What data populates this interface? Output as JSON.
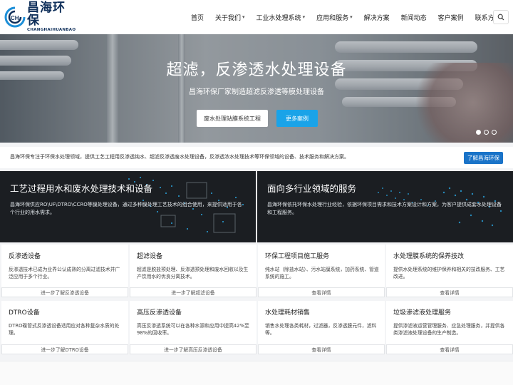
{
  "brand": {
    "name_cn": "昌海环保",
    "name_en": "CHANGHAIHUANBAO",
    "logo_mark": "CH"
  },
  "nav": {
    "items": [
      {
        "label": "首页",
        "dropdown": false
      },
      {
        "label": "关于我们",
        "dropdown": true
      },
      {
        "label": "工业水处理系统",
        "dropdown": true
      },
      {
        "label": "应用和服务",
        "dropdown": true
      },
      {
        "label": "解决方案",
        "dropdown": false
      },
      {
        "label": "新闻动态",
        "dropdown": false
      },
      {
        "label": "客户案例",
        "dropdown": false
      },
      {
        "label": "联系方式",
        "dropdown": false
      }
    ],
    "caret": "▾",
    "search_icon": "search-icon"
  },
  "hero": {
    "title": "超滤，反渗透水处理设备",
    "subtitle": "昌海环保厂家制造超滤反渗透等膜处理设备",
    "primary_button": "废水处理站膜系统工程",
    "secondary_button": "更多案例",
    "slides_total": 3,
    "active_slide": 1
  },
  "intro": {
    "text": "昌海环保专注于环保水处理领域，提供工艺工程用反渗透纯水、超滤反渗透废水处理设备，反渗透浓水处理技术等环保领域的设备、技术服务和解决方案。",
    "button": "了解昌海环保"
  },
  "features": [
    {
      "title": "工艺过程用水和废水处理技术和设备",
      "desc": "昌海环保供应RO\\UF\\DTRO\\CCRO等膜处理设备，通过多种膜处理工艺技术的组合使用，来提供适用于各个行业的用水需求。"
    },
    {
      "title": "面向多行业领域的服务",
      "desc": "昌海环保依托环保水处理行业经验，依据环保项目需求和技术方案设计和方案，为客户提供成套水处理设备和工程服务。"
    }
  ],
  "cards": [
    {
      "title": "反渗透设备",
      "desc": "反渗透技术已成为业界公认成熟的分离过滤技术并广泛应用于多个行业。",
      "link": "进一步了解反渗透设备"
    },
    {
      "title": "超滤设备",
      "desc": "超滤是脱盐预处理、反渗透预处理和废水回收以及生产饮用水的优良分离技术。",
      "link": "进一步了解超滤设备"
    },
    {
      "title": "环保工程项目施工服务",
      "desc": "纯水站（除盐水站）、污水站膜系统，加药系统、管道系统的施工。",
      "link": "查看详情"
    },
    {
      "title": "水处理膜系统的保养技改",
      "desc": "提供水处理系统的维护保养和相关的技改服务、工艺改进。",
      "link": "查看详情"
    },
    {
      "title": "DTRO设备",
      "desc": "DTRO碟管式反渗透设备适用应对各种复杂水质的处理。",
      "link": "进一步了解DTRO设备"
    },
    {
      "title": "高压反渗透设备",
      "desc": "高压反渗透系统可以在各种水源和应用中提高42%至98%的回收率。",
      "link": "进一步了解高压反渗透设备"
    },
    {
      "title": "水处理耗材销售",
      "desc": "销售水处理各类耗材，过滤器，反渗透膜元件，滤料等。",
      "link": "查看详情"
    },
    {
      "title": "垃圾渗滤液处理服务",
      "desc": "提供渗滤液运营管理服务、应急处理服务，并提供各类渗滤液处理设备的生产制造。",
      "link": "查看详情"
    }
  ],
  "colors": {
    "accent": "#1aa3e8",
    "primary_button": "#1a73c8",
    "dark_panel": "#1b1e22",
    "brand_text": "#0f2f5a"
  }
}
